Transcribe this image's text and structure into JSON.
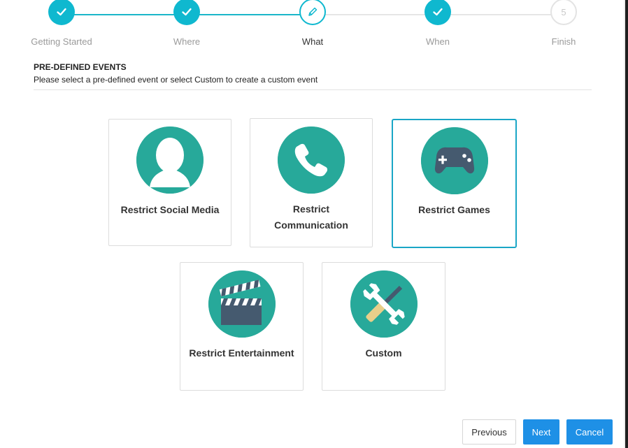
{
  "stepper": {
    "steps": [
      {
        "label": "Getting Started",
        "state": "done"
      },
      {
        "label": "Where",
        "state": "done"
      },
      {
        "label": "What",
        "state": "current"
      },
      {
        "label": "When",
        "state": "done"
      },
      {
        "label": "Finish",
        "state": "todo",
        "number": "5"
      }
    ]
  },
  "section": {
    "title": "PRE-DEFINED EVENTS",
    "description": "Please select a pre-defined event or select Custom to create a custom event"
  },
  "events": [
    {
      "label": "Restrict Social Media",
      "icon": "person-icon",
      "selected": false
    },
    {
      "label_line1": "Restrict",
      "label_line2": "Communication",
      "icon": "phone-icon",
      "selected": false
    },
    {
      "label": "Restrict Games",
      "icon": "gamepad-icon",
      "selected": true
    },
    {
      "label": "Restrict Entertainment",
      "icon": "clapperboard-icon",
      "selected": false
    },
    {
      "label": "Custom",
      "icon": "wrench-screwdriver-icon",
      "selected": false
    }
  ],
  "buttons": {
    "previous": "Previous",
    "next": "Next",
    "cancel": "Cancel"
  },
  "colors": {
    "accent": "#0fb8cf",
    "icon_background": "#27a99a",
    "icon_dark": "#455a6f",
    "selected_border": "#1aa6c6",
    "primary_button": "#1e90e6"
  }
}
